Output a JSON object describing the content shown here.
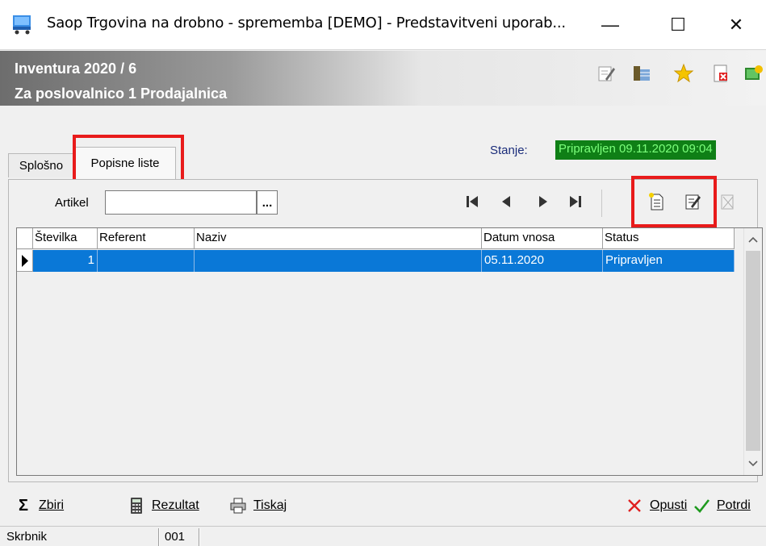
{
  "window": {
    "title": "Saop Trgovina na drobno - sprememba [DEMO] - Predstavitveni uporab...",
    "minimize": "—",
    "maximize": "☐",
    "close": "✕"
  },
  "header": {
    "line1": "Inventura 2020 / 6",
    "line2": "Za poslovalnico 1 Prodajalnica"
  },
  "status": {
    "label": "Stanje:",
    "value": "Pripravljen 09.11.2020 09:04"
  },
  "tabs": [
    {
      "label": "Splošno"
    },
    {
      "label": "Popisne liste"
    }
  ],
  "filter": {
    "label": "Artikel",
    "value": "",
    "button": "..."
  },
  "grid": {
    "columns": [
      "Številka",
      "Referent",
      "Naziv",
      "Datum vnosa",
      "Status"
    ],
    "rows": [
      {
        "stevilka": "1",
        "referent": "",
        "naziv": "",
        "datum": "05.11.2020",
        "status": "Pripravljen"
      }
    ]
  },
  "bottom_buttons": {
    "zbiri": "Zbiri",
    "rezultat": "Rezultat",
    "tiskaj": "Tiskaj",
    "opusti": "Opusti",
    "potrdi": "Potrdi"
  },
  "statusbar": {
    "user": "Skrbnik",
    "code": "001"
  },
  "colors": {
    "selection": "#0a78d7",
    "status_bg": "#0f7f16",
    "status_fg": "#7cff7c",
    "highlight": "#e81b1b"
  }
}
